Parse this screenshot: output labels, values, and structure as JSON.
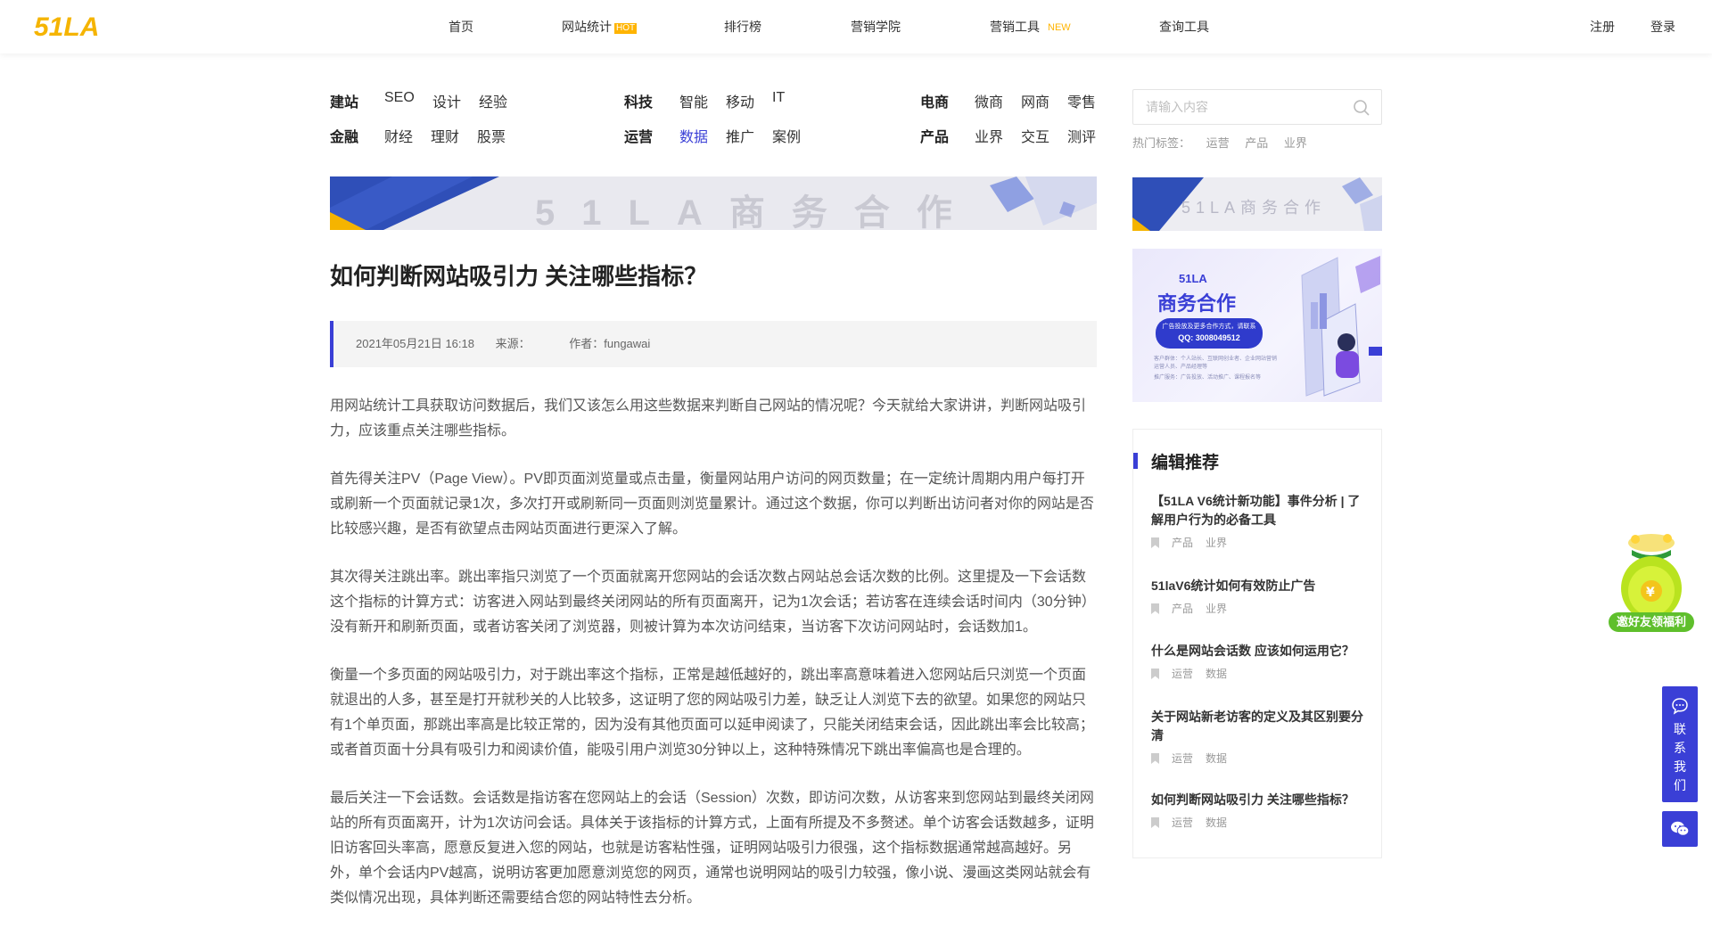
{
  "header": {
    "logo_text": "51LA",
    "nav": [
      {
        "label": "首页"
      },
      {
        "label": "网站统计",
        "badge": "HOT"
      },
      {
        "label": "排行榜"
      },
      {
        "label": "营销学院"
      },
      {
        "label": "营销工具",
        "badge": "NEW"
      },
      {
        "label": "查询工具"
      }
    ],
    "register": "注册",
    "login": "登录"
  },
  "categories": [
    {
      "head": "建站",
      "links": [
        "SEO",
        "设计",
        "经验"
      ]
    },
    {
      "head": "科技",
      "links": [
        "智能",
        "移动",
        "IT"
      ]
    },
    {
      "head": "电商",
      "links": [
        "微商",
        "网商",
        "零售"
      ]
    },
    {
      "head": "金融",
      "links": [
        "财经",
        "理财",
        "股票"
      ]
    },
    {
      "head": "运营",
      "links": [
        "数据",
        "推广",
        "案例"
      ]
    },
    {
      "head": "产品",
      "links": [
        "业界",
        "交互",
        "测评"
      ]
    }
  ],
  "search": {
    "placeholder": "请输入内容",
    "hot_label": "热门标签：",
    "hot_tags": [
      "运营",
      "产品",
      "业界"
    ]
  },
  "banners": {
    "main_text": "51LA商务合作",
    "side_text": "51LA商务合作",
    "ad_title_top": "51LA",
    "ad_title": "商务合作",
    "ad_line1": "广告投放及更多合作方式，请联系",
    "ad_qq": "QQ: 3008049512",
    "ad_small1": "客户群体：个人站长、互联网创业者、企业网站营销运营人员、产品经理等",
    "ad_small2": "推广服务：广告投放、活动推广、课程报名等"
  },
  "article": {
    "title": "如何判断网站吸引力 关注哪些指标？",
    "date": "2021年05月21日 16:18",
    "source_label": "来源：",
    "author": "作者：fungawai",
    "paragraphs": [
      "用网站统计工具获取访问数据后，我们又该怎么用这些数据来判断自己网站的情况呢？今天就给大家讲讲，判断网站吸引力，应该重点关注哪些指标。",
      "首先得关注PV（Page View）。PV即页面浏览量或点击量，衡量网站用户访问的网页数量；在一定统计周期内用户每打开或刷新一个页面就记录1次，多次打开或刷新同一页面则浏览量累计。通过这个数据，你可以判断出访问者对你的网站是否比较感兴趣，是否有欲望点击网站页面进行更深入了解。",
      "其次得关注跳出率。跳出率指只浏览了一个页面就离开您网站的会话次数占网站总会话次数的比例。这里提及一下会话数这个指标的计算方式：访客进入网站到最终关闭网站的所有页面离开，记为1次会话；若访客在连续会话时间内（30分钟）没有新开和刷新页面，或者访客关闭了浏览器，则被计算为本次访问结束，当访客下次访问网站时，会话数加1。",
      "衡量一个多页面的网站吸引力，对于跳出率这个指标，正常是越低越好的，跳出率高意味着进入您网站后只浏览一个页面就退出的人多，甚至是打开就秒关的人比较多，这证明了您的网站吸引力差，缺乏让人浏览下去的欲望。如果您的网站只有1个单页面，那跳出率高是比较正常的，因为没有其他页面可以延申阅读了，只能关闭结束会话，因此跳出率会比较高；或者首页面十分具有吸引力和阅读价值，能吸引用户浏览30分钟以上，这种特殊情况下跳出率偏高也是合理的。",
      "最后关注一下会话数。会话数是指访客在您网站上的会话（Session）次数，即访问次数，从访客来到您网站到最终关闭网站的所有页面离开，计为1次访问会话。具体关于该指标的计算方式，上面有所提及不多赘述。单个访客会话数越多，证明旧访客回头率高，愿意反复进入您的网站，也就是访客粘性强，证明网站吸引力很强，这个指标数据通常越高越好。另外，单个会话内PV越高，说明访客更加愿意浏览您的网页，通常也说明网站的吸引力较强，像小说、漫画这类网站就会有类似情况出现，具体判断还需要结合您的网站特性去分析。"
    ]
  },
  "editor_picks": {
    "title": "编辑推荐",
    "items": [
      {
        "title": "【51LA V6统计新功能】事件分析 | 了解用户行为的必备工具",
        "tags": [
          "产品",
          "业界"
        ]
      },
      {
        "title": "51laV6统计如何有效防止广告",
        "tags": [
          "产品",
          "业界"
        ]
      },
      {
        "title": "什么是网站会话数 应该如何运用它？",
        "tags": [
          "运营",
          "数据"
        ]
      },
      {
        "title": "关于网站新老访客的定义及其区别要分清",
        "tags": [
          "运营",
          "数据"
        ]
      },
      {
        "title": "如何判断网站吸引力 关注哪些指标？",
        "tags": [
          "运营",
          "数据"
        ]
      }
    ]
  },
  "floating": {
    "gift_label": "邀好友领福利",
    "contact_label": "联系我们"
  },
  "colors": {
    "accent": "#3a3fd6",
    "logo": "#f5b400",
    "hot": "#ffb400"
  }
}
